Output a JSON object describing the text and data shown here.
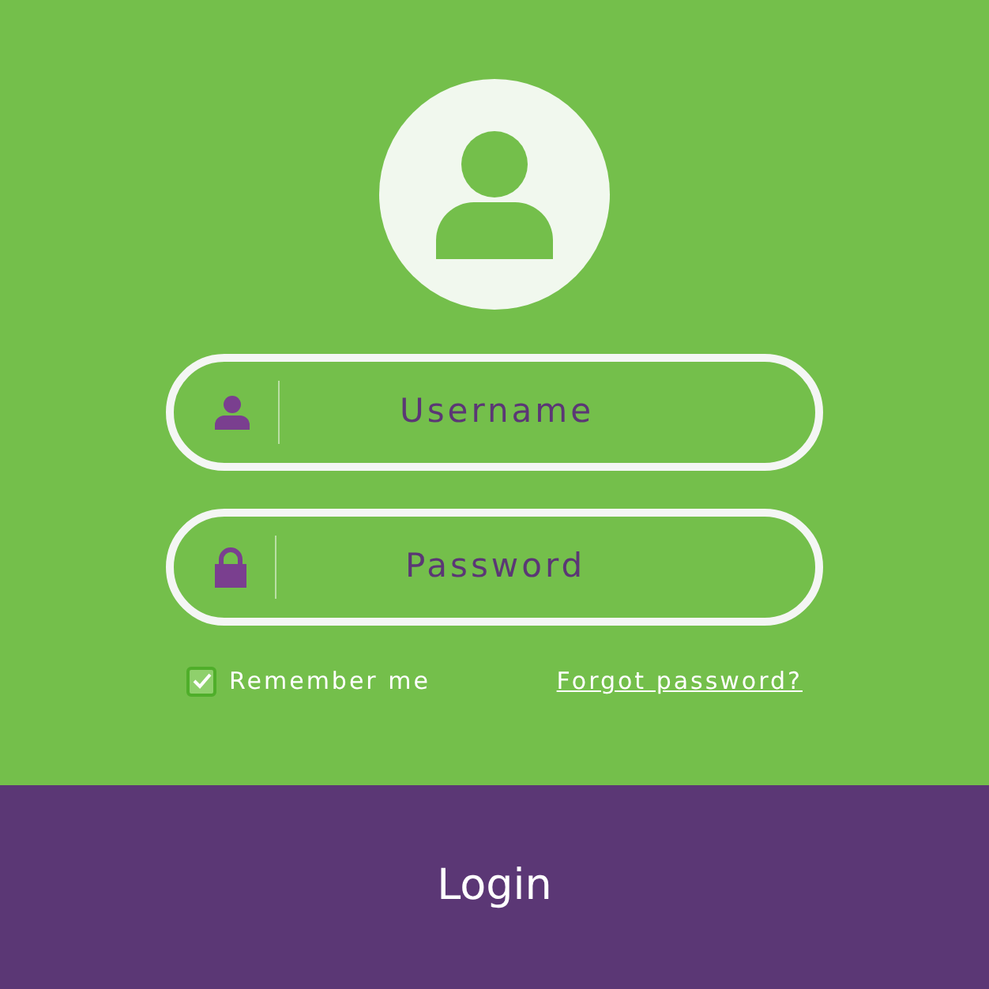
{
  "fields": [
    {
      "kind": "user",
      "placeholder": "Username"
    },
    {
      "kind": "lock",
      "placeholder": "Password"
    }
  ],
  "remember": {
    "label": "Remember me",
    "checked": true
  },
  "forgot_link": "Forgot password?",
  "login_button": "Login"
}
